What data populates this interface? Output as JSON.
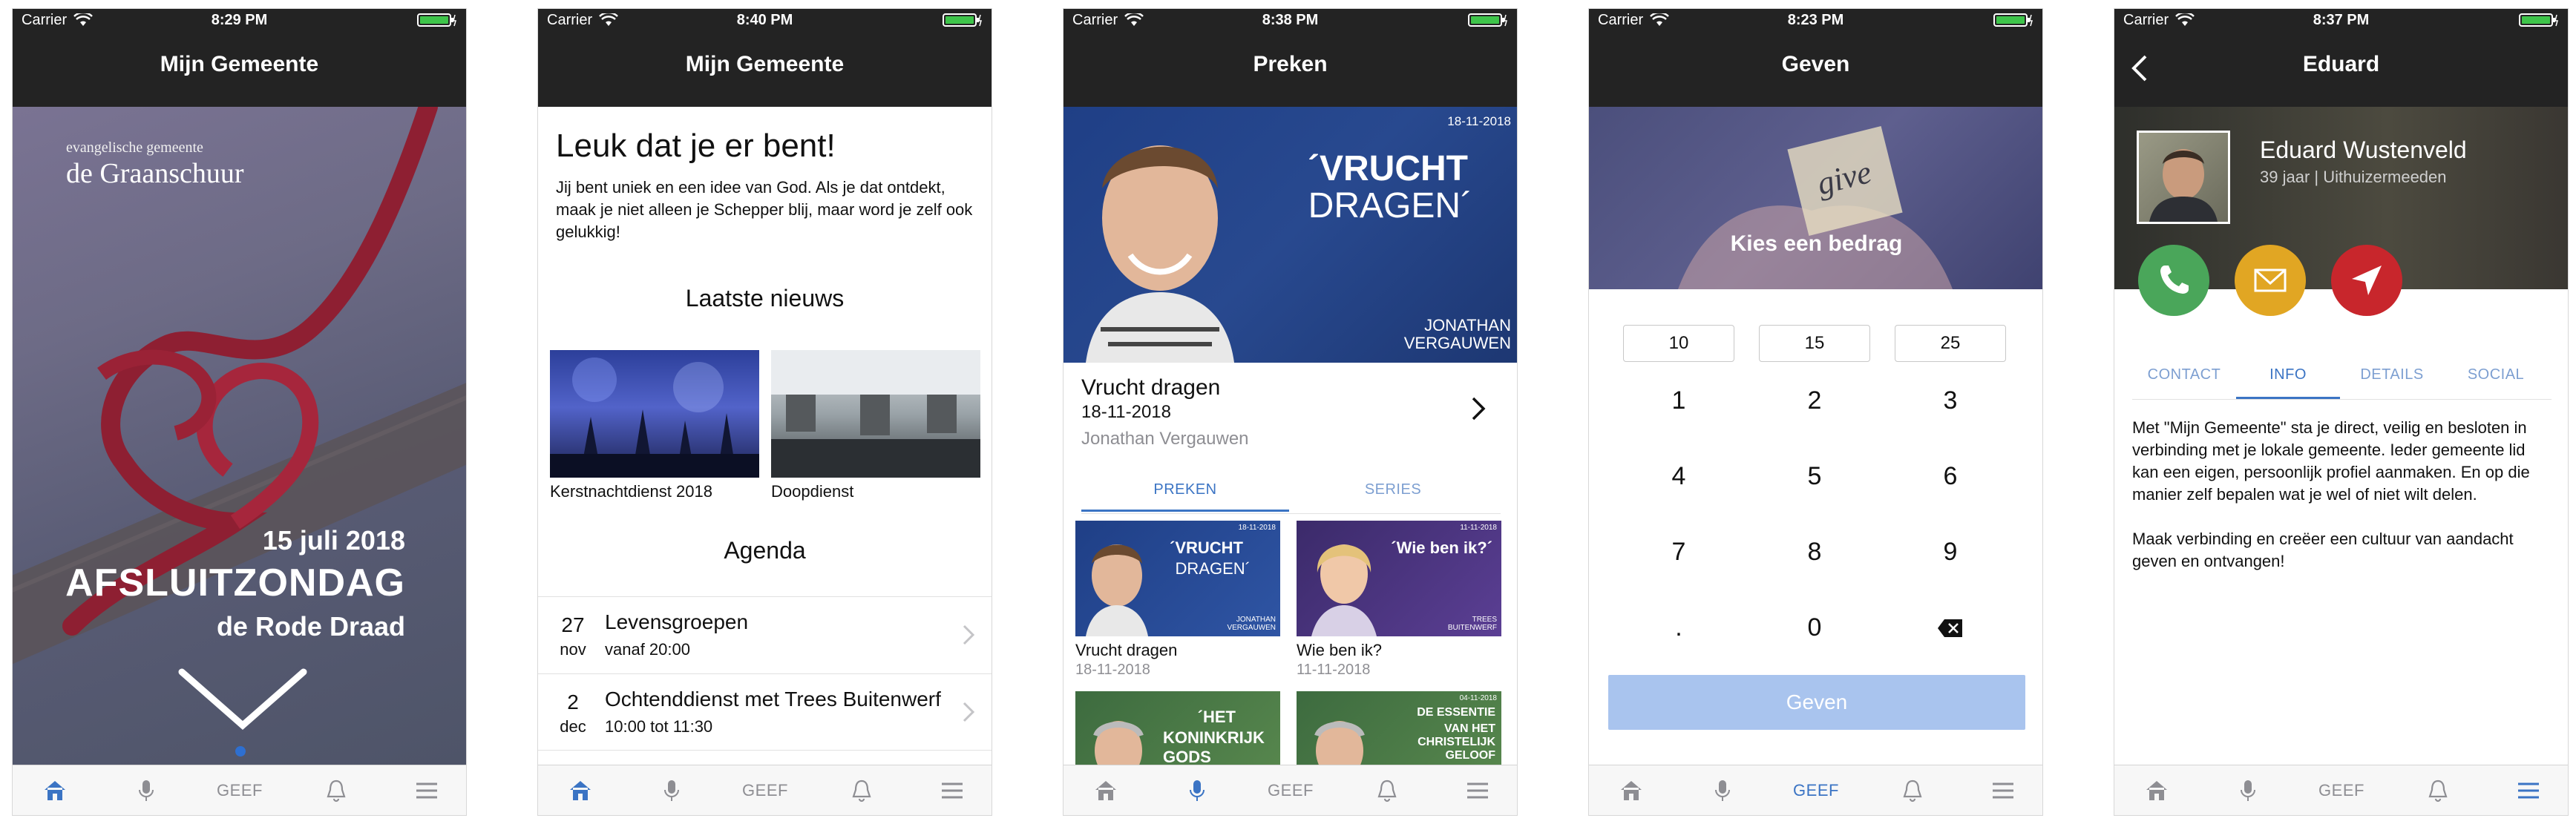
{
  "colors": {
    "navbar": "#232323",
    "accent": "#3b74c4",
    "tab_inactive": "#8e8e93",
    "geef_button": "#a9c4ee",
    "call": "#4aa65a",
    "mail": "#e1a623",
    "route": "#c8262c"
  },
  "status": {
    "carrier": "Carrier",
    "times": [
      "8:29 PM",
      "8:40 PM",
      "8:38 PM",
      "8:23 PM",
      "8:37 PM"
    ]
  },
  "tabbar": {
    "geef_label": "GEEF",
    "icons": [
      "home-icon",
      "microphone-icon",
      "geef",
      "bell-icon",
      "menu-icon"
    ]
  },
  "screen1": {
    "title": "Mijn Gemeente",
    "logo_small": "evangelische gemeente",
    "logo_big": "de Graanschuur",
    "date": "15 juli 2018",
    "event_title": "AFSLUITZONDAG",
    "event_subtitle": "de Rode Draad"
  },
  "screen2": {
    "title": "Mijn Gemeente",
    "heading": "Leuk dat je er bent!",
    "intro": "Jij bent uniek en een idee van God. Als je dat ontdekt, maak je niet alleen je Schepper blij, maar word je zelf ook gelukkig!",
    "news_heading": "Laatste nieuws",
    "news": [
      {
        "caption": "Kerstnachtdienst 2018"
      },
      {
        "caption": "Doopdienst"
      }
    ],
    "agenda_heading": "Agenda",
    "agenda": [
      {
        "day": "27",
        "month": "nov",
        "title": "Levensgroepen",
        "time": "vanaf 20:00"
      },
      {
        "day": "2",
        "month": "dec",
        "title": "Ochtenddienst met Trees Buitenwerf",
        "time": "10:00 tot 11:30"
      }
    ]
  },
  "screen3": {
    "title": "Preken",
    "hero": {
      "date": "18-11-2018",
      "line1": "´VRUCHT",
      "line2": "DRAGEN´",
      "speaker1": "JONATHAN",
      "speaker2": "VERGAUWEN"
    },
    "sermon_title": "Vrucht dragen",
    "sermon_date": "18-11-2018",
    "sermon_speaker": "Jonathan Vergauwen",
    "tabs": [
      "PREKEN",
      "SERIES"
    ],
    "grid": [
      {
        "thumb_l1": "´VRUCHT",
        "thumb_l2": "DRAGEN´",
        "thumb_date": "18-11-2018",
        "thumb_sp": "JONATHAN VERGAUWEN",
        "caption": "Vrucht dragen",
        "date": "18-11-2018"
      },
      {
        "thumb_l1": "´Wie ben ik?´",
        "thumb_l2": "",
        "thumb_date": "11-11-2018",
        "thumb_sp": "TREES BUITENWERF",
        "caption": "Wie ben ik?",
        "date": "11-11-2018"
      },
      {
        "thumb_l1": "´HET",
        "thumb_l2": "KONINKRIJK GODS",
        "thumb_date": "",
        "thumb_sp": "",
        "caption": "",
        "date": ""
      },
      {
        "thumb_l1": "DE ESSENTIE",
        "thumb_l2": "VAN HET CHRISTELIJK GELOOF",
        "thumb_date": "04-11-2018",
        "thumb_sp": "",
        "caption": "",
        "date": ""
      }
    ]
  },
  "screen4": {
    "title": "Geven",
    "hero_word": "give",
    "hero_label": "Kies een bedrag",
    "amounts": [
      "10",
      "15",
      "25"
    ],
    "keys": [
      "1",
      "2",
      "3",
      "4",
      "5",
      "6",
      "7",
      "8",
      "9",
      ".",
      "0"
    ],
    "button": "Geven"
  },
  "screen5": {
    "title": "Eduard",
    "name": "Eduard Wustenveld",
    "meta": "39 jaar | Uithuizermeeden",
    "tabs": [
      "CONTACT",
      "INFO",
      "DETAILS",
      "SOCIAL"
    ],
    "para1": "Met \"Mijn Gemeente\" sta je direct, veilig en besloten in verbinding met je lokale gemeente. Ieder gemeente lid kan een eigen, persoonlijk profiel aanmaken. En op die manier zelf bepalen wat je wel of niet wilt delen.",
    "para2": "Maak verbinding en creëer een cultuur van aandacht geven en ontvangen!"
  }
}
